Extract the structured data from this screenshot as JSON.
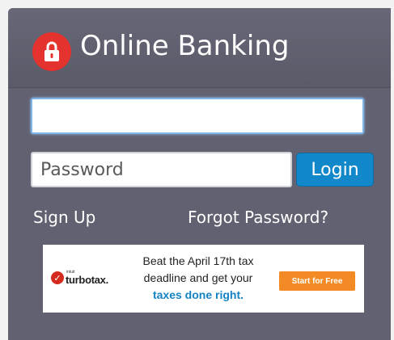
{
  "colors": {
    "panel": "#616171",
    "lock_badge": "#e4322f",
    "login_button": "#1287c9",
    "ad_cta": "#f28b25",
    "ad_emphasis": "#1483c6"
  },
  "header": {
    "icon": "lock-icon",
    "title": "Online Banking"
  },
  "form": {
    "username": {
      "value": "",
      "placeholder": ""
    },
    "password": {
      "value": "",
      "placeholder": "Password"
    },
    "login_label": "Login"
  },
  "links": {
    "signup": "Sign Up",
    "forgot": "Forgot Password?"
  },
  "ad": {
    "logo_small": "intuit",
    "logo_brand": "turbotax.",
    "line1": "Beat the April 17th tax",
    "line2": "deadline and get your",
    "line3": "taxes done right.",
    "cta": "Start for Free"
  }
}
